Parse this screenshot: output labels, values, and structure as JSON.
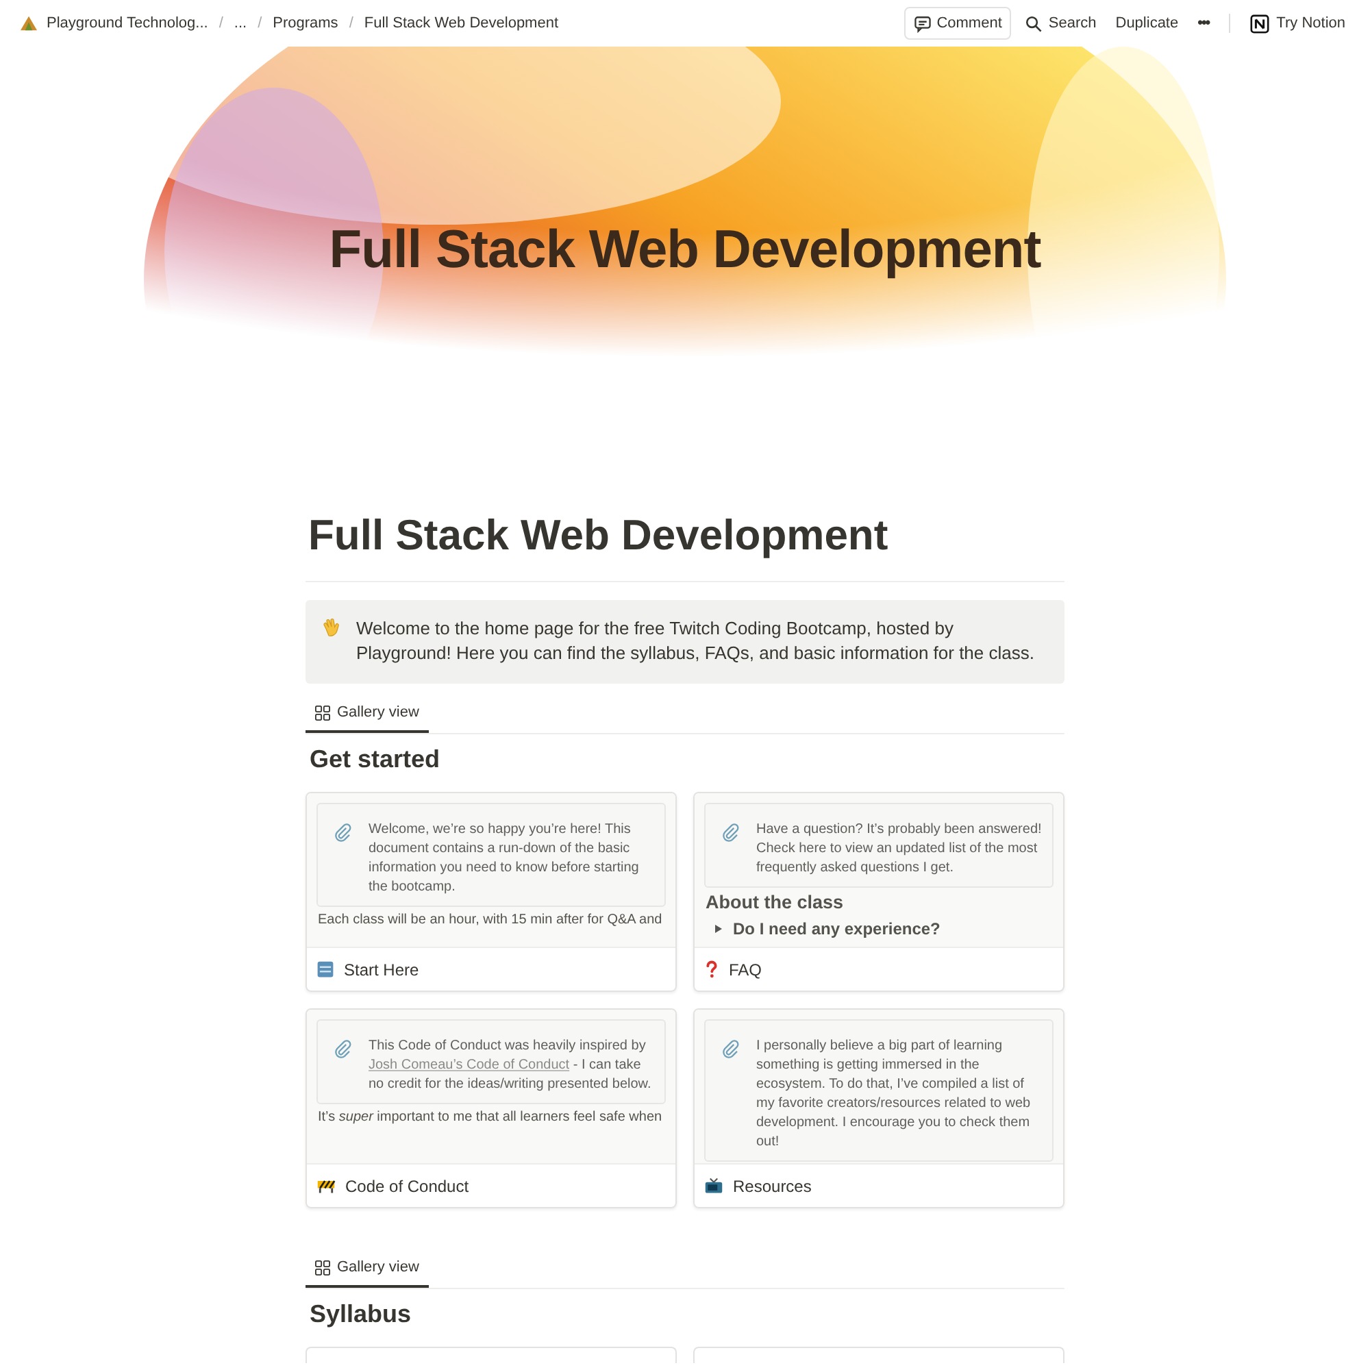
{
  "topbar": {
    "separator": "/",
    "breadcrumbs": [
      {
        "label": "Playground Technolog...",
        "kind": "workspace"
      },
      {
        "label": "...",
        "kind": "crumb"
      },
      {
        "label": "Programs",
        "kind": "crumb"
      },
      {
        "label": "Full Stack Web Development",
        "kind": "crumb"
      }
    ],
    "actions": [
      {
        "label": "Comment",
        "kind": "comment"
      },
      {
        "label": "Search",
        "kind": "search"
      },
      {
        "label": "Duplicate",
        "kind": "plain"
      },
      {
        "label": "•••",
        "kind": "more"
      },
      {
        "label": "Try Notion",
        "kind": "notion"
      }
    ]
  },
  "cover": {
    "title": "Full Stack Web Development"
  },
  "page": {
    "title": "Full Stack Web Development",
    "callout": {
      "text": "Welcome to the home page for the free Twitch Coding Bootcamp, hosted by Playground! Here you can find the syllabus, FAQs, and basic information for the class."
    },
    "galleries": [
      {
        "tabs": [
          {
            "label": "Gallery view",
            "selected": true
          }
        ],
        "heading": "Get started",
        "cards": [
          {
            "title": "Start Here",
            "callout": [
              {
                "kind": "text",
                "text": "Welcome, we’re so happy you’re here! This document contains a run-down of the basic information you need to know before starting the bootcamp."
              }
            ],
            "blocks": [
              {
                "kind": "paragraph",
                "text": "Each class will be an hour, with 15 min after for Q&A and"
              }
            ]
          },
          {
            "title": "FAQ",
            "callout": [
              {
                "kind": "text",
                "text": "Have a question? It’s probably been answered! Check here to view an updated list of the most frequently asked questions I get."
              }
            ],
            "blocks": [
              {
                "kind": "heading",
                "text": "About the class"
              },
              {
                "kind": "toggle",
                "text": "Do I need any experience?",
                "expanded": false
              }
            ]
          },
          {
            "title": "Code of Conduct",
            "callout": [
              {
                "kind": "text",
                "text": "This Code of Conduct was heavily inspired by "
              },
              {
                "kind": "link",
                "text": "Josh Comeau’s Code of Conduct"
              },
              {
                "kind": "text",
                "text": " - I can take no credit for the ideas/writing presented below."
              }
            ],
            "blocks": [
              {
                "kind": "paragraph",
                "text": "It’s *super* important to me that all learners feel safe when"
              }
            ]
          },
          {
            "title": "Resources",
            "callout": [
              {
                "kind": "text",
                "text": "I personally believe a big part of learning something is getting immersed in the ecosystem. To do that, I’ve compiled a list of my favorite creators/resources related to web development. I encourage you to check them out!"
              }
            ]
          }
        ]
      },
      {
        "tabs": [
          {
            "label": "Gallery view",
            "selected": true
          }
        ],
        "heading": "Syllabus",
        "cards": [
          {
            "kind": "partial"
          },
          {
            "kind": "partial"
          }
        ]
      }
    ]
  }
}
